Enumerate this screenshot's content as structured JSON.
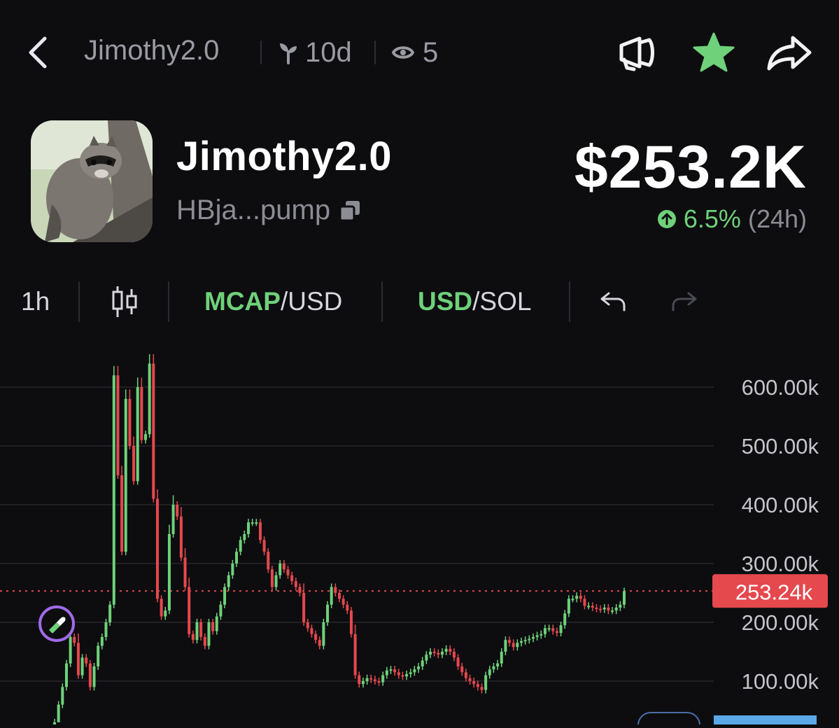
{
  "header": {
    "back_icon": "chevron-left-icon",
    "title": "Jimothy2.0",
    "age": "10d",
    "age_icon": "sprout-icon",
    "views": "5",
    "views_icon": "eye-icon",
    "actions": [
      {
        "icon": "megaphone-icon"
      },
      {
        "icon": "star-icon",
        "active": true,
        "color": "#6fd17a"
      },
      {
        "icon": "share-arrow-icon"
      }
    ]
  },
  "token": {
    "name": "Jimothy2.0",
    "address": "HBja...pump",
    "avatar": "raccoon-avatar",
    "market_cap": "$253.2K",
    "change_pct": "6.5%",
    "change_period": "(24h)",
    "change_direction": "up"
  },
  "toolbar": {
    "interval": "1h",
    "chart_type_icon": "candlestick-icon",
    "mcap_toggle": {
      "active": "MCAP",
      "rest": "/USD"
    },
    "currency_toggle": {
      "active": "USD",
      "rest": "/SOL"
    },
    "undo_icon": "undo-icon",
    "redo_icon": "redo-icon"
  },
  "colors": {
    "up": "#6fd17a",
    "down": "#e5484d",
    "accent": "#6fd17a",
    "price_tag": "#e5484d",
    "marker_ring": "#a06be8"
  },
  "chart_data": {
    "type": "candlestick",
    "interval": "1h",
    "y_ticks": [
      "600.00k",
      "500.00k",
      "400.00k",
      "300.00k",
      "200.00k",
      "100.00k"
    ],
    "y_tick_values": [
      600,
      500,
      400,
      300,
      200,
      100
    ],
    "ylim": [
      30,
      670
    ],
    "unit": "k",
    "current_price_label": "253.24k",
    "current_price": 253.24,
    "grid": true,
    "series_close": [
      30,
      60,
      90,
      130,
      175,
      165,
      110,
      140,
      130,
      90,
      125,
      160,
      175,
      200,
      230,
      620,
      450,
      320,
      580,
      500,
      440,
      600,
      510,
      520,
      640,
      410,
      240,
      210,
      220,
      350,
      400,
      380,
      310,
      260,
      180,
      170,
      200,
      175,
      160,
      200,
      185,
      210,
      230,
      260,
      280,
      300,
      320,
      340,
      350,
      370,
      370,
      370,
      340,
      320,
      290,
      260,
      280,
      300,
      290,
      280,
      270,
      260,
      250,
      200,
      190,
      180,
      170,
      160,
      200,
      230,
      260,
      250,
      240,
      230,
      220,
      180,
      110,
      95,
      100,
      105,
      103,
      100,
      98,
      110,
      118,
      120,
      115,
      110,
      108,
      112,
      115,
      120,
      125,
      135,
      145,
      150,
      148,
      145,
      150,
      155,
      150,
      140,
      125,
      115,
      105,
      100,
      95,
      90,
      85,
      110,
      120,
      125,
      130,
      150,
      170,
      165,
      158,
      165,
      168,
      170,
      172,
      175,
      178,
      180,
      190,
      190,
      185,
      182,
      195,
      215,
      240,
      240,
      245,
      240,
      228,
      228,
      225,
      223,
      222,
      225,
      220,
      220,
      225,
      230,
      253
    ]
  }
}
